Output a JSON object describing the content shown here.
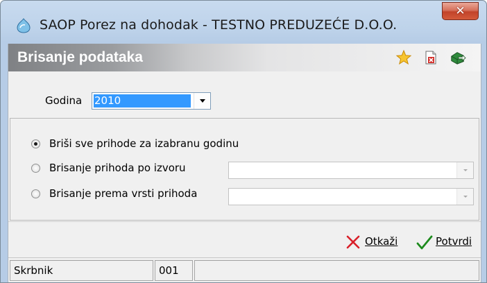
{
  "window": {
    "title": "SAOP Porez na dohodak - TESTNO PREDUZEĆE D.O.O.",
    "close_glyph": "✕"
  },
  "header": {
    "title": "Brisanje podataka",
    "icons": [
      "star-icon",
      "delete-document-icon",
      "exit-icon"
    ]
  },
  "year": {
    "label": "Godina",
    "value": "2010",
    "accent": "#3399ff"
  },
  "options": [
    {
      "label": "Briši sve prihode za izabranu godinu",
      "selected": true
    },
    {
      "label": "Brisanje prihoda po izvoru",
      "selected": false
    },
    {
      "label": "Brisanje prema vrsti prihoda",
      "selected": false
    }
  ],
  "source_combo": {
    "value": ""
  },
  "type_combo": {
    "value": ""
  },
  "actions": {
    "cancel": "Otkaži",
    "confirm": "Potvrdi",
    "cancel_color": "#d9202a",
    "confirm_color": "#1d8a1d"
  },
  "status": {
    "user": "Skrbnik",
    "code": "001",
    "extra": ""
  }
}
